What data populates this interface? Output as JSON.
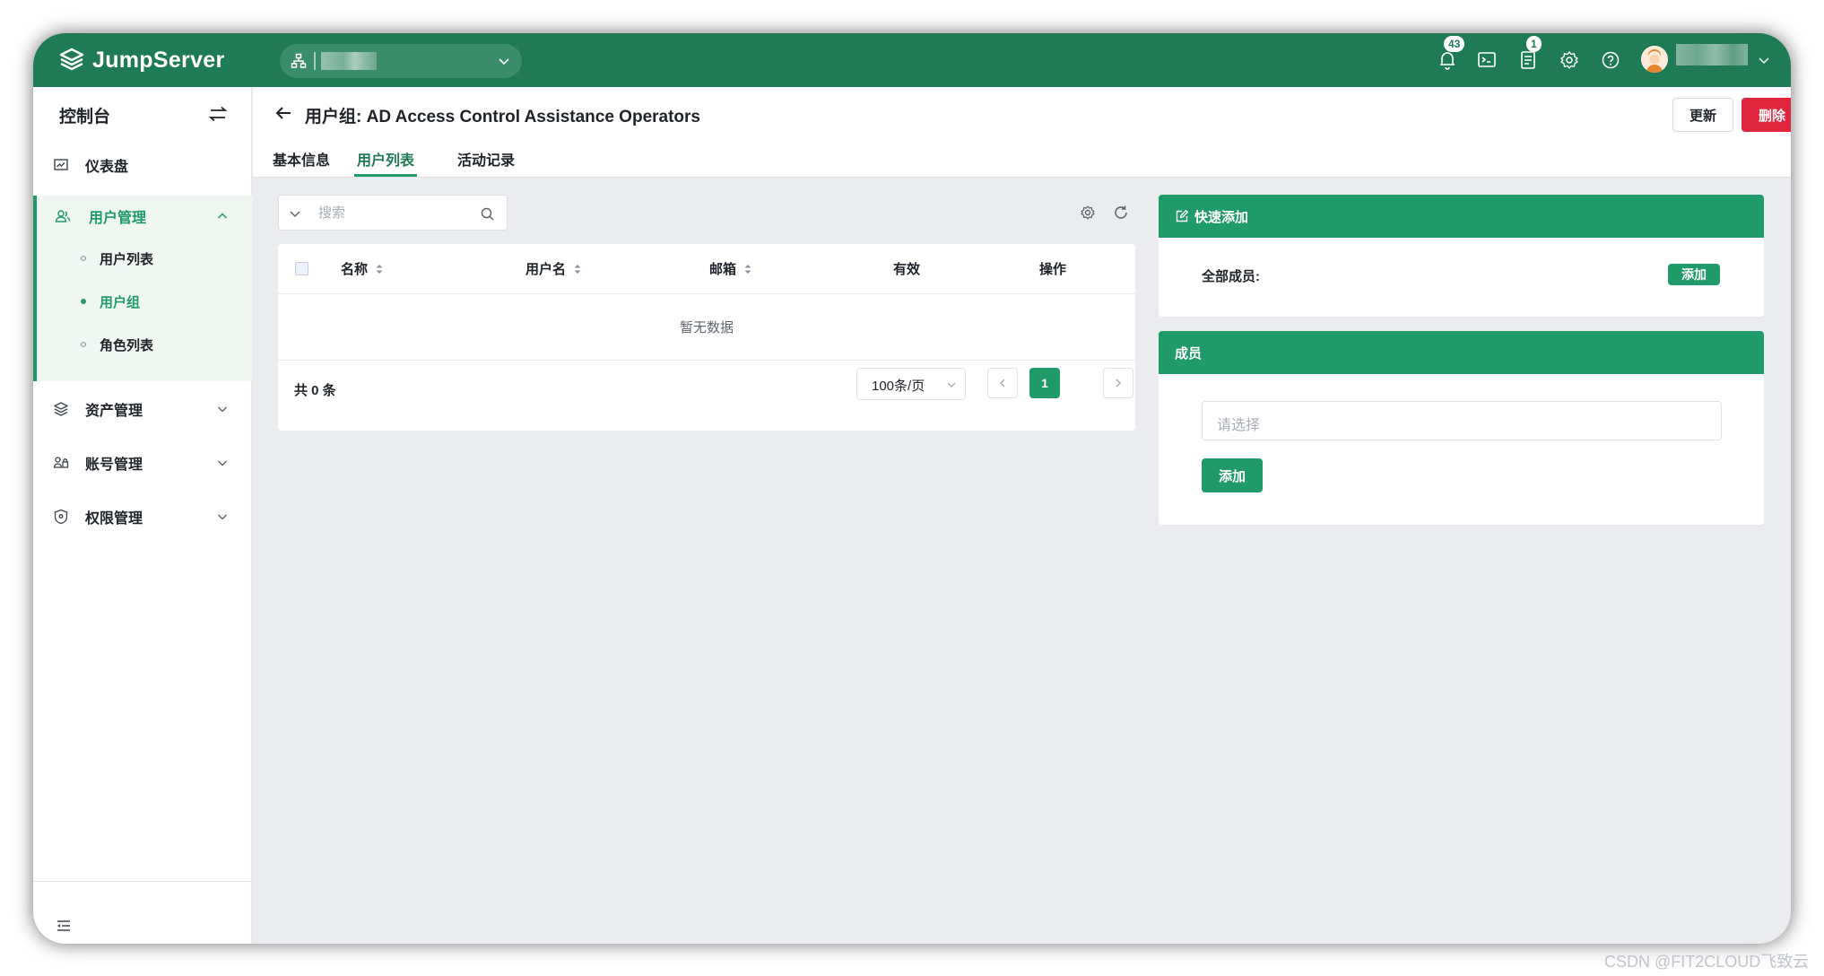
{
  "app": {
    "brand": "JumpServer",
    "accent": "#1f7a56",
    "accent_light": "#1f9a68",
    "danger": "#e0263f"
  },
  "navbar": {
    "notifications_count": "43",
    "tickets_count": "1",
    "icons": [
      "bell-icon",
      "terminal-icon",
      "tickets-icon",
      "settings-icon",
      "help-icon",
      "user-avatar",
      "chevron-down-icon"
    ]
  },
  "sidebar": {
    "title": "控制台",
    "items": [
      {
        "label": "仪表盘",
        "icon": "dashboard-icon"
      },
      {
        "label": "用户管理",
        "icon": "users-icon",
        "expanded": true,
        "children": [
          {
            "label": "用户列表",
            "active": false
          },
          {
            "label": "用户组",
            "active": true
          },
          {
            "label": "角色列表",
            "active": false
          }
        ]
      },
      {
        "label": "资产管理",
        "icon": "assets-icon"
      },
      {
        "label": "账号管理",
        "icon": "accounts-icon"
      },
      {
        "label": "权限管理",
        "icon": "shield-icon"
      }
    ]
  },
  "page": {
    "title": "用户组: AD Access Control Assistance Operators",
    "update_label": "更新",
    "delete_label": "删除",
    "tabs": [
      {
        "label": "基本信息",
        "active": false
      },
      {
        "label": "用户列表",
        "active": true
      },
      {
        "label": "活动记录",
        "active": false
      }
    ]
  },
  "table": {
    "search_placeholder": "搜索",
    "columns": [
      "名称",
      "用户名",
      "邮箱",
      "有效",
      "操作"
    ],
    "empty_text": "暂无数据",
    "total": "共 0 条",
    "page_size": "100条/页",
    "current_page": "1"
  },
  "quick_add": {
    "title": "快速添加",
    "all_members_label": "全部成员:",
    "add_label": "添加"
  },
  "members": {
    "title": "成员",
    "select_placeholder": "请选择",
    "add_label": "添加"
  },
  "watermark": "CSDN @FIT2CLOUD飞致云"
}
